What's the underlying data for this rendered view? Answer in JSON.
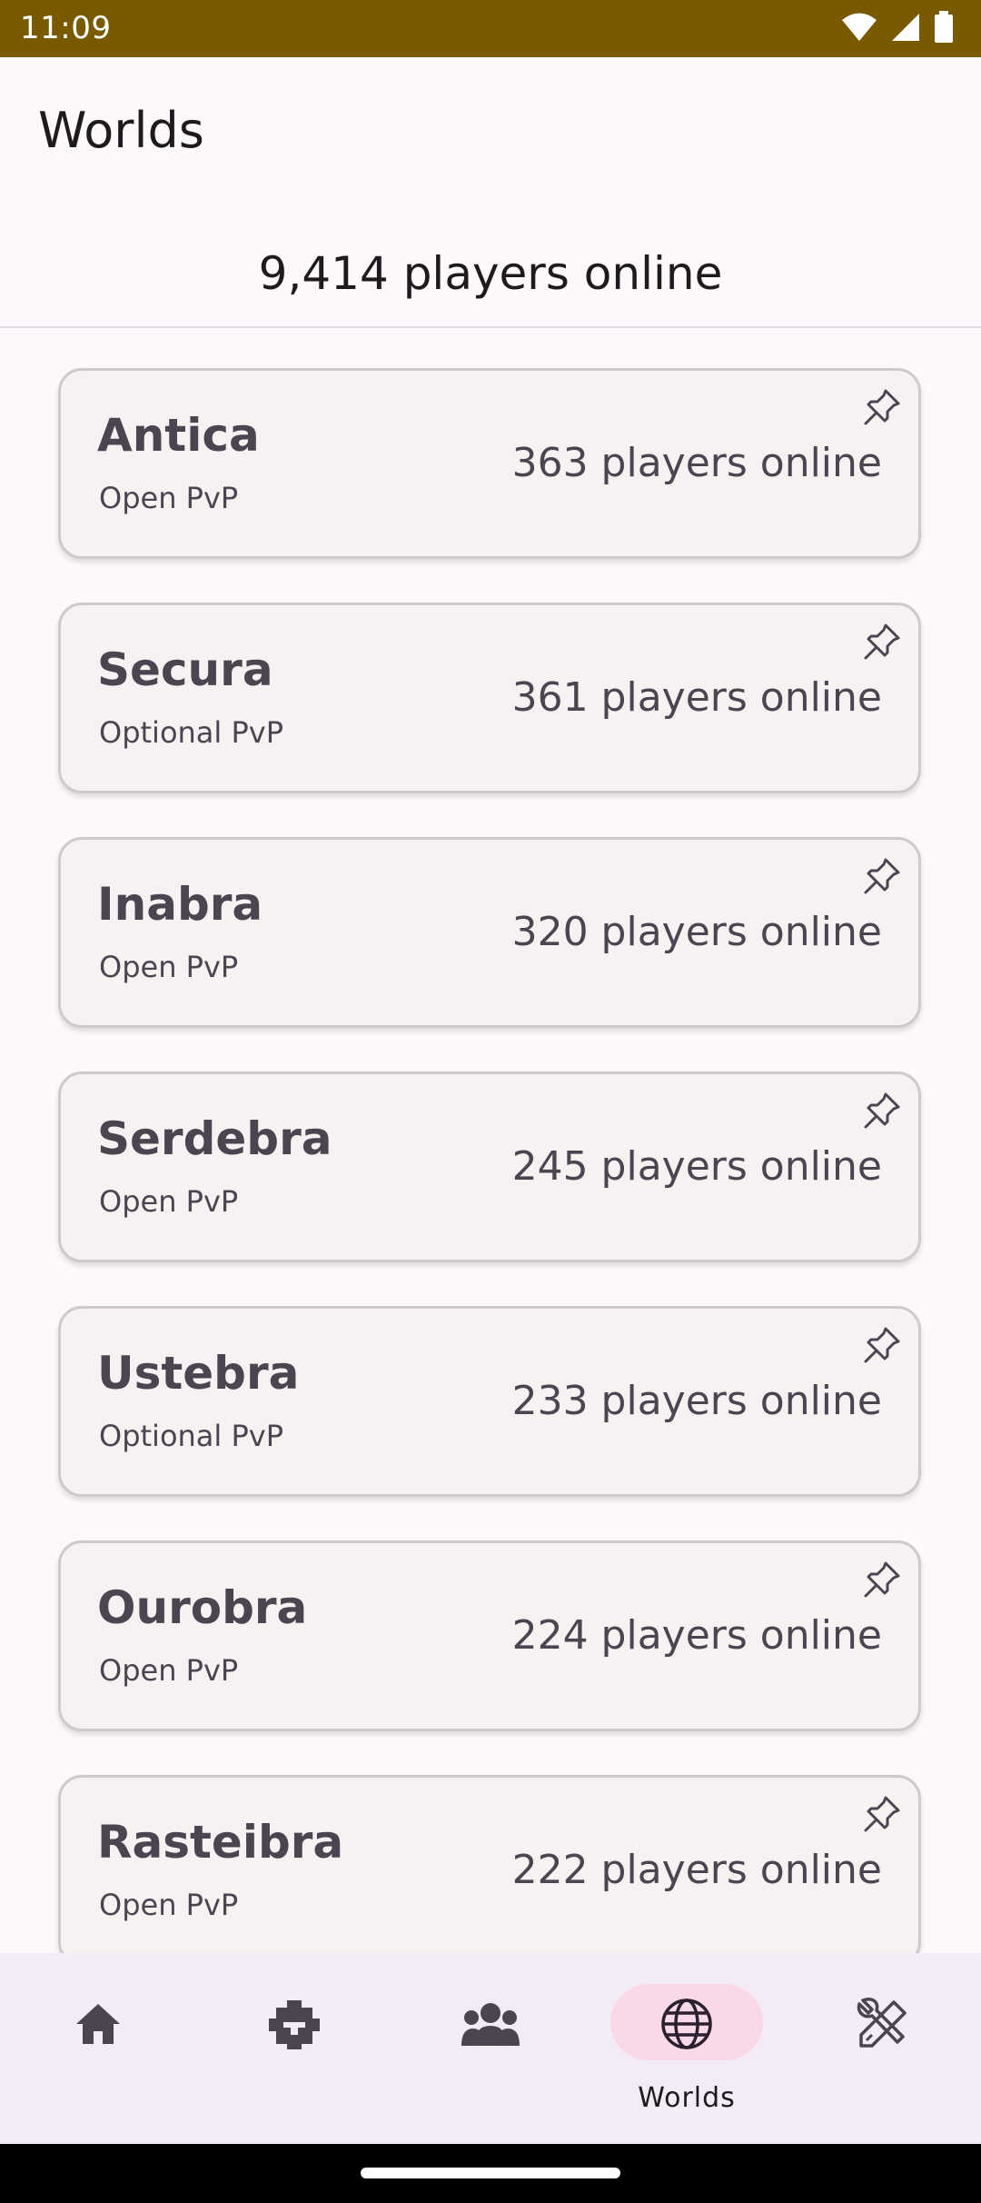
{
  "status_bar": {
    "time": "11:09",
    "icons": [
      "wifi-icon",
      "signal-icon",
      "battery-icon"
    ]
  },
  "app_bar": {
    "title": "Worlds"
  },
  "summary": {
    "total_online": "9,414 players online"
  },
  "worlds": [
    {
      "name": "Antica",
      "type": "Open PvP",
      "online": "363 players online"
    },
    {
      "name": "Secura",
      "type": "Optional PvP",
      "online": "361 players online"
    },
    {
      "name": "Inabra",
      "type": "Open PvP",
      "online": "320 players online"
    },
    {
      "name": "Serdebra",
      "type": "Open PvP",
      "online": "245 players online"
    },
    {
      "name": "Ustebra",
      "type": "Optional PvP",
      "online": "233 players online"
    },
    {
      "name": "Ourobra",
      "type": "Open PvP",
      "online": "224 players online"
    },
    {
      "name": "Rasteibra",
      "type": "Open PvP",
      "online": "222 players online"
    }
  ],
  "bottom_nav": {
    "items": [
      {
        "icon": "home-icon",
        "label": ""
      },
      {
        "icon": "puzzle-icon",
        "label": ""
      },
      {
        "icon": "group-icon",
        "label": ""
      },
      {
        "icon": "globe-icon",
        "label": "Worlds",
        "selected": true
      },
      {
        "icon": "tools-icon",
        "label": ""
      }
    ]
  },
  "colors": {
    "status_bar": "#7a5a00",
    "background": "#fcf8fc",
    "card": "#f7f2f2",
    "card_border": "#cfc9c9",
    "nav_background": "#f3ebf6",
    "nav_selected_pill": "#f9d8e8",
    "text_secondary": "#4a4550"
  }
}
